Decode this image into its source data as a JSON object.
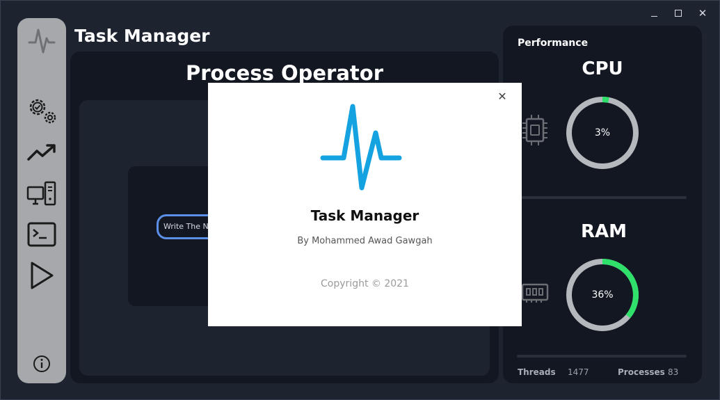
{
  "window": {
    "title": "Task Manager",
    "controls": {
      "minimize": "",
      "maximize": "",
      "close": "✕"
    }
  },
  "sidebar": {
    "items": [
      {
        "name": "app-logo-icon",
        "icon": "pulse"
      },
      {
        "name": "settings-icon",
        "icon": "gears"
      },
      {
        "name": "performance-icon",
        "icon": "trending-up"
      },
      {
        "name": "computer-icon",
        "icon": "desktop"
      },
      {
        "name": "terminal-icon",
        "icon": "terminal"
      },
      {
        "name": "run-icon",
        "icon": "play"
      },
      {
        "name": "info-icon",
        "icon": "info"
      }
    ]
  },
  "main": {
    "heading": "Process Operator",
    "input": {
      "placeholder": "Write The Na"
    }
  },
  "performance": {
    "title": "Performance",
    "cpu": {
      "label": "CPU",
      "percent": 3,
      "display": "3%"
    },
    "ram": {
      "label": "RAM",
      "percent": 36,
      "display": "36%"
    },
    "threads": {
      "label": "Threads",
      "value": "1477"
    },
    "processes": {
      "label": "Processes",
      "value": "83"
    }
  },
  "about": {
    "close": "✕",
    "title": "Task Manager",
    "author": "By Mohammed Awad Gawgah",
    "copyright": "Copyright © 2021"
  },
  "colors": {
    "background": "#1e2330",
    "panel": "#131722",
    "sidebar": "#a6a8ab",
    "gauge_track": "#b5b8bd",
    "gauge_fill": "#2fe06a",
    "logo_blue": "#14a3e0",
    "input_border": "#5b8fe8"
  }
}
